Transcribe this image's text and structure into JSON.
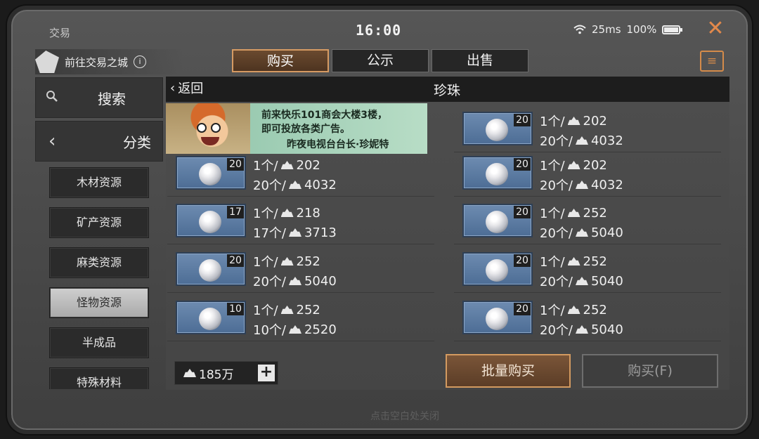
{
  "status_bar": {
    "title": "交易",
    "time": "16:00",
    "ping": "25ms",
    "battery": "100%",
    "battery_level": 1.0
  },
  "header": {
    "city_link": "前往交易之城",
    "tabs": [
      {
        "label": "购买",
        "active": true
      },
      {
        "label": "公示",
        "active": false
      },
      {
        "label": "出售",
        "active": false
      }
    ]
  },
  "sidebar": {
    "search_label": "搜索",
    "category_label": "分类",
    "items": [
      {
        "label": "木材资源",
        "selected": false
      },
      {
        "label": "矿产资源",
        "selected": false
      },
      {
        "label": "麻类资源",
        "selected": false
      },
      {
        "label": "怪物资源",
        "selected": true
      },
      {
        "label": "半成品",
        "selected": false
      },
      {
        "label": "特殊材料",
        "selected": false
      }
    ]
  },
  "panel": {
    "back_label": "返回",
    "category_title": "珍珠"
  },
  "ad": {
    "line1": "前来快乐101商会大楼3楼，",
    "line2": "即可投放各类广告。",
    "line3": "昨夜电视台台长·珍妮特"
  },
  "listings": [
    {
      "qty": "20",
      "unit": "1个/",
      "unit_price": "202",
      "total_label": "20个/",
      "total_price": "4032"
    },
    {
      "qty": "20",
      "unit": "1个/",
      "unit_price": "202",
      "total_label": "20个/",
      "total_price": "4032"
    },
    {
      "qty": "20",
      "unit": "1个/",
      "unit_price": "202",
      "total_label": "20个/",
      "total_price": "4032"
    },
    {
      "qty": "17",
      "unit": "1个/",
      "unit_price": "218",
      "total_label": "17个/",
      "total_price": "3713"
    },
    {
      "qty": "20",
      "unit": "1个/",
      "unit_price": "252",
      "total_label": "20个/",
      "total_price": "5040"
    },
    {
      "qty": "20",
      "unit": "1个/",
      "unit_price": "252",
      "total_label": "20个/",
      "total_price": "5040"
    },
    {
      "qty": "20",
      "unit": "1个/",
      "unit_price": "252",
      "total_label": "20个/",
      "total_price": "5040"
    },
    {
      "qty": "10",
      "unit": "1个/",
      "unit_price": "252",
      "total_label": "10个/",
      "total_price": "2520"
    },
    {
      "qty": "20",
      "unit": "1个/",
      "unit_price": "252",
      "total_label": "20个/",
      "total_price": "5040"
    }
  ],
  "footer": {
    "funds": "185万",
    "bulk_buy_label": "批量购买",
    "buy_label": "购买(F)",
    "close_hint": "点击空白处关闭"
  },
  "colors": {
    "accent": "#d69b63",
    "close": "#e3894b",
    "thumb_bg": "#5b7aa2"
  },
  "icons": [
    "wifi-icon",
    "battery-icon",
    "close-icon",
    "city-logo-icon",
    "info-icon",
    "clipboard-icon",
    "search-icon",
    "chevron-left-icon",
    "pearl-icon",
    "currency-icon",
    "plus-icon"
  ]
}
